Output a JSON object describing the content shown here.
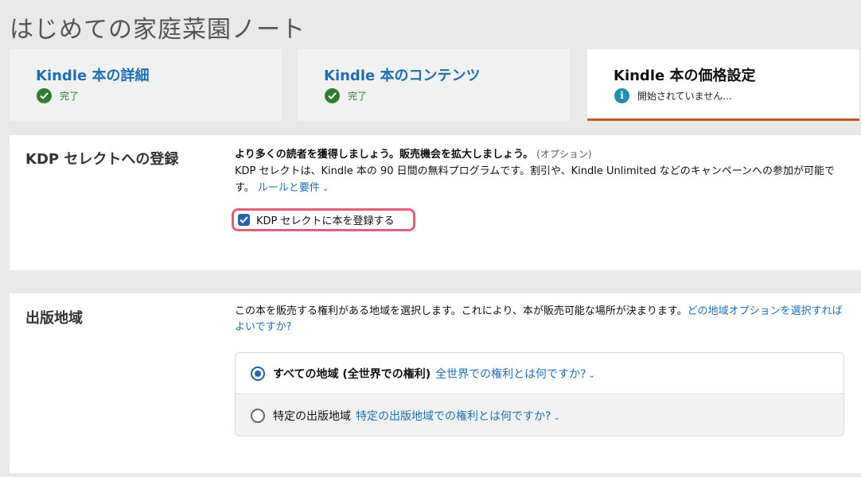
{
  "book_title": "はじめての家庭菜園ノート",
  "tabs": [
    {
      "label": "Kindle 本の詳細",
      "status": "完了",
      "status_icon": "check-circle-icon"
    },
    {
      "label": "Kindle 本のコンテンツ",
      "status": "完了",
      "status_icon": "check-circle-icon"
    },
    {
      "label": "Kindle 本の価格設定",
      "status": "開始されていません...",
      "status_icon": "info-circle-icon"
    }
  ],
  "kdp_select": {
    "title": "KDP セレクトへの登録",
    "headline": "より多くの読者を獲得しましょう。販売機会を拡大しましょう。",
    "optional": "(オプション)",
    "description": "KDP セレクトは、Kindle 本の 90 日間の無料プログラムです。割引や、Kindle Unlimited などのキャンペーンへの参加が可能です。",
    "rules_link": "ルールと要件",
    "enroll_label": "KDP セレクトに本を登録する",
    "enroll_checked": true
  },
  "territory": {
    "title": "出版地域",
    "description": "この本を販売する権利がある地域を選択します。これにより、本が販売可能な場所が決まります。",
    "help_link": "どの地域オプションを選択すればよいですか?",
    "options": [
      {
        "label": "すべての地域 (全世界での権利)",
        "link": "全世界での権利とは何ですか?",
        "selected": true
      },
      {
        "label": "特定の出版地域",
        "link": "特定の出版地域での権利とは何ですか?",
        "selected": false
      }
    ]
  },
  "colors": {
    "link": "#1f6fb2",
    "complete_green": "#2f7d32",
    "active_tab_underline": "#c45a1b",
    "highlight_border": "#e0607a",
    "control_blue": "#2b5faf"
  }
}
